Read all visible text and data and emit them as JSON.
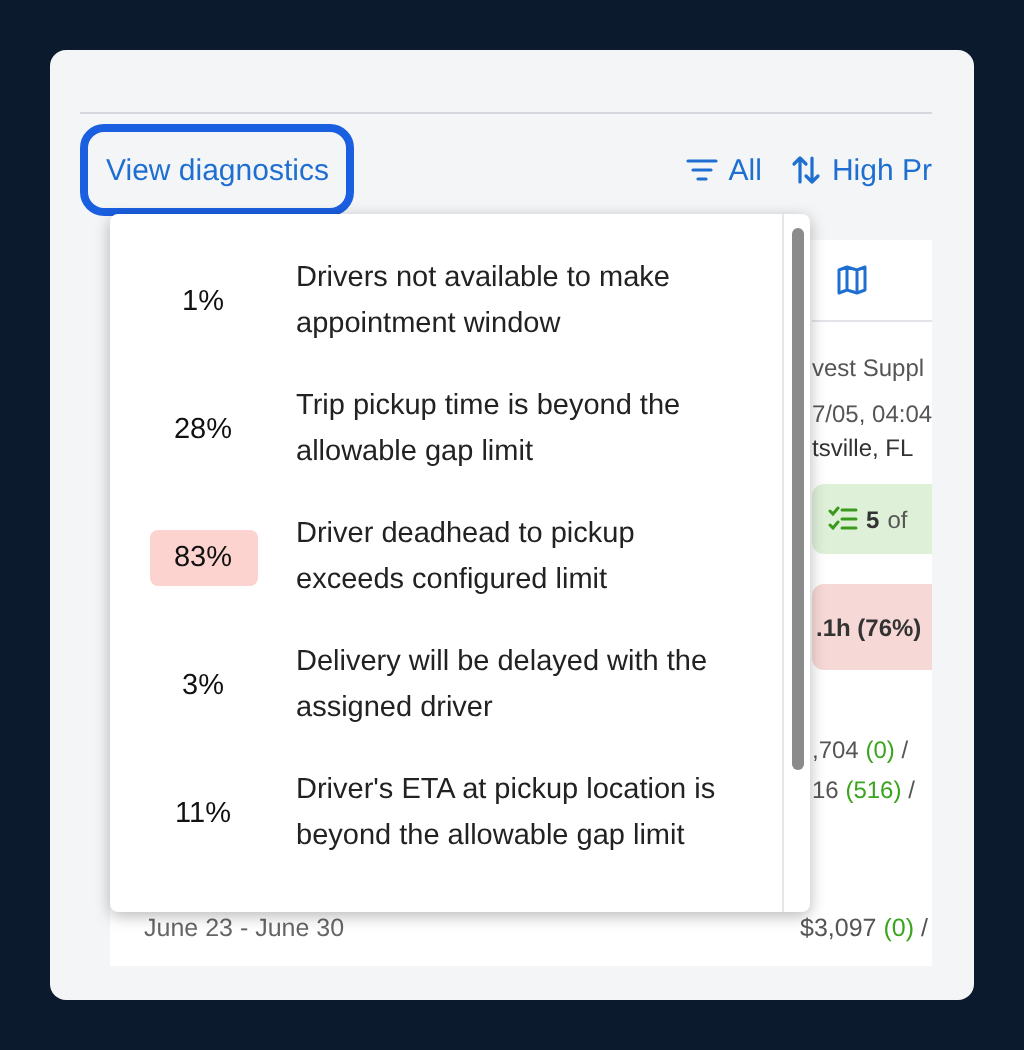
{
  "toolbar": {
    "diagnostics_button": "View diagnostics",
    "filter": "All",
    "sort": "High Pr"
  },
  "background_panel": {
    "customer": "vest Suppl",
    "datetime": "7/05, 04:04",
    "location": "tsville, FL",
    "checklist_badge": {
      "count": "5",
      "suffix": "of"
    },
    "duration_badge": ".1h (76%)",
    "amounts": [
      {
        "value": ",704",
        "delta": "(0)",
        "rest": "/"
      },
      {
        "value": "16",
        "delta": "(516)",
        "rest": "/"
      }
    ],
    "weeks": [
      {
        "range": "June 23 - June 30",
        "value": "$3,097",
        "delta": "(0)",
        "rest": "/"
      }
    ]
  },
  "diagnostics_popup": {
    "items": [
      {
        "percent": "1%",
        "text": "Drivers not available to make appointment window",
        "highlighted": false
      },
      {
        "percent": "28%",
        "text": "Trip pickup time is beyond the allowable gap limit",
        "highlighted": false
      },
      {
        "percent": "83%",
        "text": "Driver deadhead to pickup exceeds configured limit",
        "highlighted": true
      },
      {
        "percent": "3%",
        "text": "Delivery will be delayed with the assigned driver",
        "highlighted": false
      },
      {
        "percent": "11%",
        "text": "Driver's ETA at pickup location is beyond the allowable gap limit",
        "highlighted": false
      }
    ]
  }
}
